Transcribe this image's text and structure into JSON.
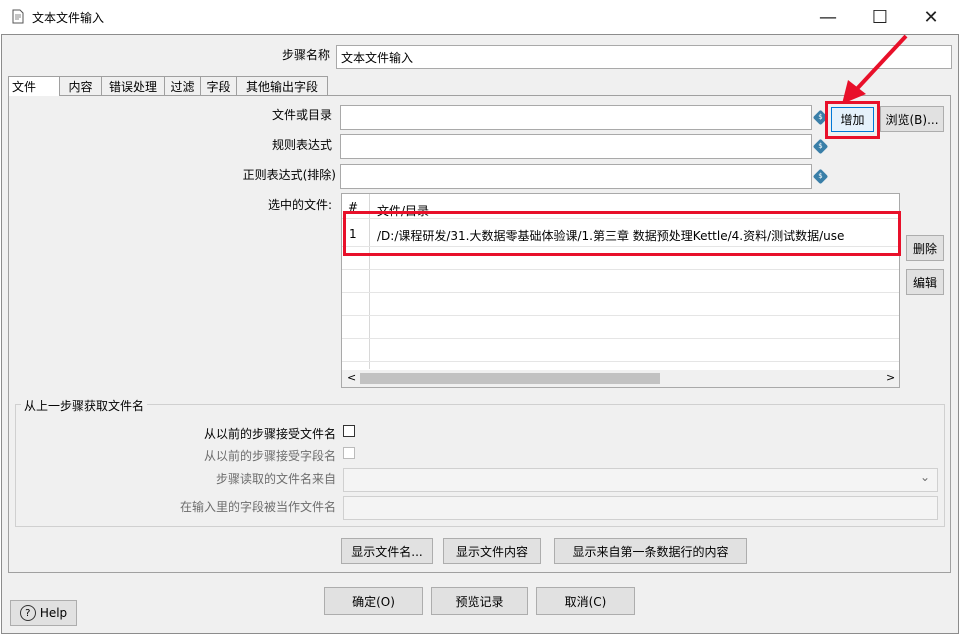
{
  "window": {
    "title": "文本文件输入",
    "minimize": "—",
    "maximize": "☐",
    "close": "✕"
  },
  "step_name": {
    "label": "步骤名称",
    "value": "文本文件输入"
  },
  "tabs": [
    {
      "label": "文件"
    },
    {
      "label": "内容"
    },
    {
      "label": "错误处理"
    },
    {
      "label": "过滤"
    },
    {
      "label": "字段"
    },
    {
      "label": "其他输出字段"
    }
  ],
  "file_tab": {
    "file_or_dir_label": "文件或目录",
    "regex_label": "规则表达式",
    "regex_exclude_label": "正则表达式(排除)",
    "selected_files_label": "选中的文件:",
    "add_button": "增加",
    "browse_button": "浏览(B)...",
    "delete_button": "删除",
    "edit_button": "编辑",
    "variable_icon_glyph": "$",
    "table": {
      "col_num": "#",
      "col_file": "文件/目录",
      "rows": [
        {
          "num": "1",
          "file": "/D:/课程研发/31.大数据零基础体验课/1.第三章 数据预处理Kettle/4.资料/测试数据/use"
        }
      ],
      "scroll_left": "<",
      "scroll_right": ">"
    },
    "prev_step_group": {
      "title": "从上一步骤获取文件名",
      "accept_filenames": "从以前的步骤接受文件名",
      "accept_fields": "从以前的步骤接受字段名",
      "step_source": "步骤读取的文件名来自",
      "field_as_filename": "在输入里的字段被当作文件名",
      "dropdown_arrow": "⌄"
    },
    "show_filenames": "显示文件名...",
    "show_content": "显示文件内容",
    "show_first_row": "显示来自第一条数据行的内容"
  },
  "footer": {
    "ok": "确定(O)",
    "preview": "预览记录",
    "cancel": "取消(C)",
    "help": "Help",
    "help_glyph": "?"
  },
  "colors": {
    "annotation_red": "#e8102a",
    "variable_icon": "#3a7fa8"
  }
}
